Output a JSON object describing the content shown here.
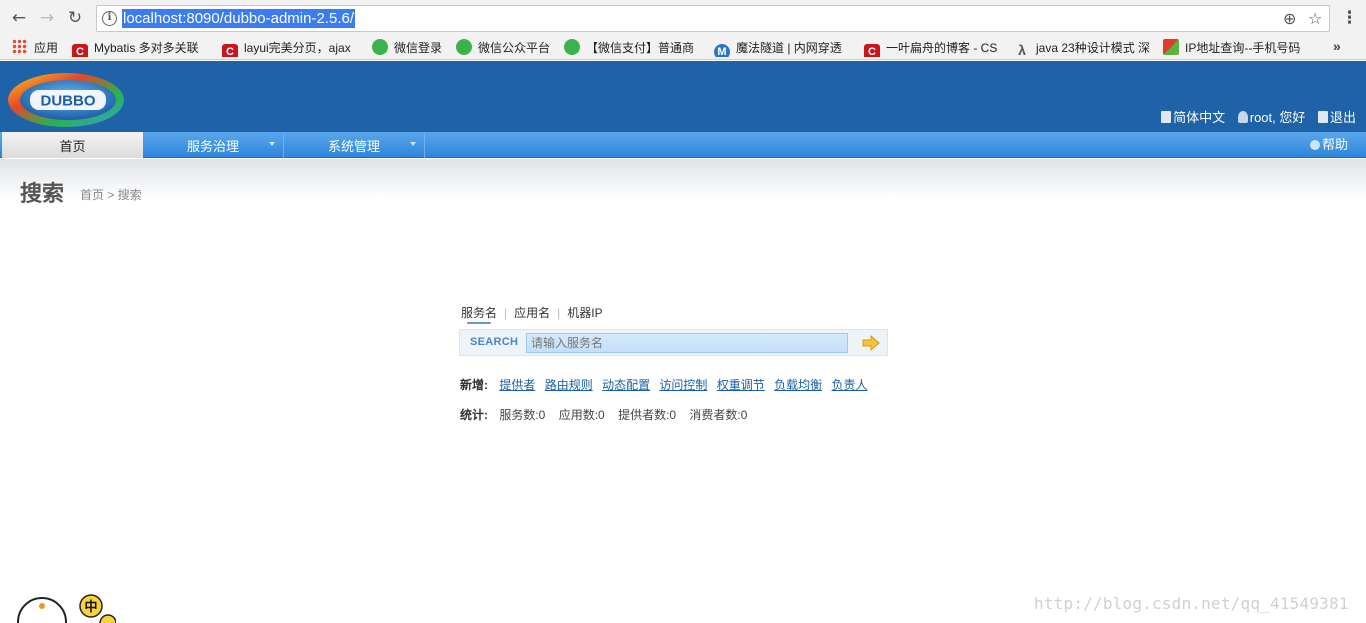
{
  "browser": {
    "url": "localhost:8090/dubbo-admin-2.5.6/",
    "bookmarks": [
      {
        "label": "应用",
        "icon": "apps-grid-icon"
      },
      {
        "label": "Mybatis 多对多关联",
        "icon": "csdn-icon"
      },
      {
        "label": "layui完美分页，ajax",
        "icon": "csdn-icon"
      },
      {
        "label": "微信登录",
        "icon": "wechat-icon"
      },
      {
        "label": "微信公众平台",
        "icon": "wechat-icon"
      },
      {
        "label": "【微信支付】普通商",
        "icon": "wechat-icon"
      },
      {
        "label": "魔法隧道 | 内网穿透",
        "icon": "tunnel-icon"
      },
      {
        "label": "一叶扁舟的博客 - CS",
        "icon": "csdn-icon"
      },
      {
        "label": "java 23种设计模式 深",
        "icon": "lambda-icon"
      },
      {
        "label": "IP地址查询--手机号码",
        "icon": "ip-icon"
      }
    ],
    "more": "»"
  },
  "header": {
    "logo_text": "DUBBO",
    "language": "简体中文",
    "user": "root, 您好",
    "logout": "退出"
  },
  "menu": {
    "items": [
      "首页",
      "服务治理",
      "系统管理"
    ],
    "help": "帮助"
  },
  "page": {
    "title": "搜索",
    "breadcrumb": "首页 > 搜索"
  },
  "search": {
    "tabs": [
      "服务名",
      "应用名",
      "机器IP"
    ],
    "label": "SEARCH",
    "placeholder": "请输入服务名"
  },
  "add": {
    "label": "新增:",
    "links": [
      "提供者",
      "路由规则",
      "动态配置",
      "访问控制",
      "权重调节",
      "负载均衡",
      "负责人"
    ]
  },
  "stats": {
    "label": "统计:",
    "items": [
      "服务数:0",
      "应用数:0",
      "提供者数:0",
      "消费者数:0"
    ]
  },
  "watermark": "http://blog.csdn.net/qq_41549381",
  "ime_char": "中"
}
